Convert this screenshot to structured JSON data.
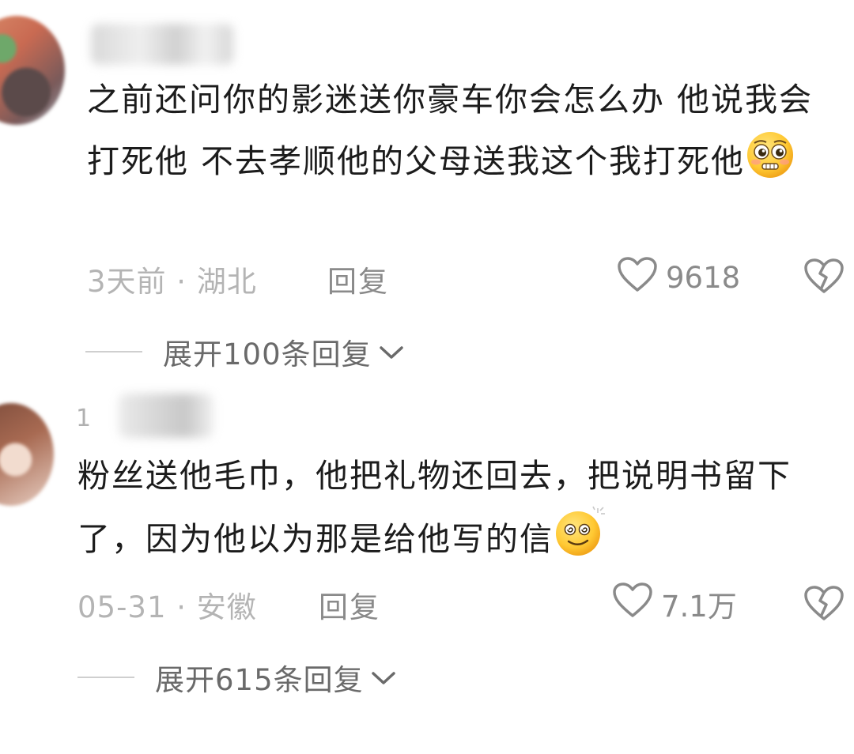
{
  "comments": [
    {
      "text": "之前还问你的影迷送你豪车你会怎么办 他说我会打死他 不去孝顺他的父母送我这个我打死他",
      "emoji": "pleading-face-emoji",
      "time_location": "3天前 · 湖北",
      "reply_label": "回复",
      "like_count": "9618",
      "expand_label": "展开100条回复"
    },
    {
      "username_prefix": "1",
      "text": "粉丝送他毛巾，他把礼物还回去，把说明书留下了，因为他以为那是给他写的信",
      "emoji": "dizzy-smile-emoji",
      "time_location": "05-31 · 安徽",
      "reply_label": "回复",
      "like_count": "7.1万",
      "expand_label": "展开615条回复"
    }
  ],
  "icons": {
    "like": "heart-outline-icon",
    "dislike": "broken-heart-icon",
    "expand": "chevron-down-icon"
  },
  "colors": {
    "text": "#1c1c1c",
    "meta": "#b4b4b4",
    "action": "#8a8a8a",
    "emoji_face": "#ffcc33"
  }
}
